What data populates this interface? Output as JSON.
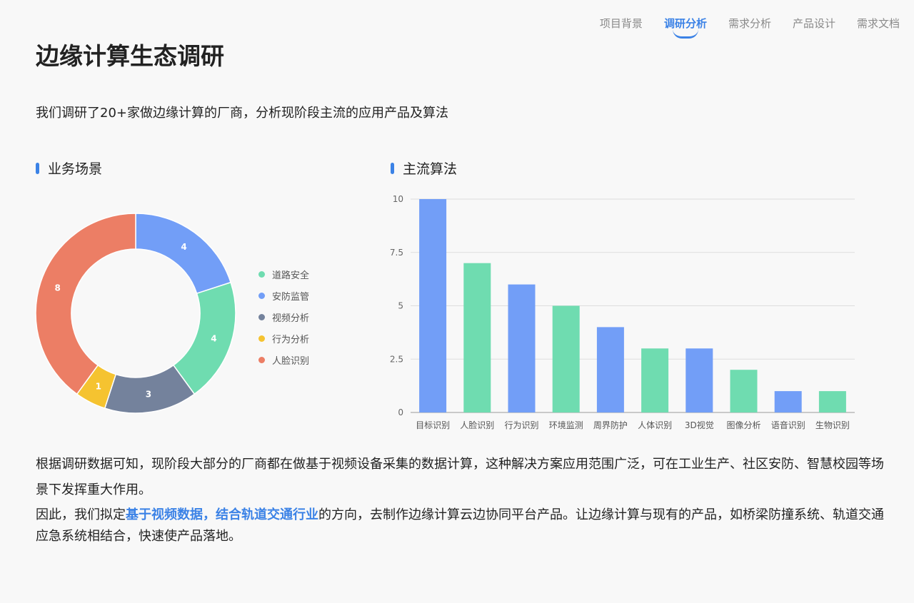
{
  "nav": {
    "items": [
      "项目背景",
      "调研分析",
      "需求分析",
      "产品设计",
      "需求文档"
    ],
    "active_index": 1
  },
  "page_title": "边缘计算生态调研",
  "subtitle": "我们调研了20+家做边缘计算的厂商，分析现阶段主流的应用产品及算法",
  "sections": {
    "left_title": "业务场景",
    "right_title": "主流算法"
  },
  "colors": {
    "accent": "#3b82e6",
    "green": "#6fdcb0",
    "blue": "#729ef7",
    "slate": "#74829c",
    "yellow": "#f5c330",
    "red": "#ec7e65"
  },
  "chart_data": [
    {
      "type": "pie",
      "donut": true,
      "title": "业务场景",
      "categories": [
        "道路安全",
        "安防监管",
        "视频分析",
        "行为分析",
        "人脸识别"
      ],
      "values": [
        4,
        4,
        3,
        1,
        8
      ],
      "slice_order": [
        "安防监管",
        "道路安全",
        "视频分析",
        "行为分析",
        "人脸识别"
      ],
      "colors": [
        "#6fdcb0",
        "#729ef7",
        "#74829c",
        "#f5c330",
        "#ec7e65"
      ],
      "legend_position": "right"
    },
    {
      "type": "bar",
      "title": "主流算法",
      "categories": [
        "目标识别",
        "人脸识别",
        "行为识别",
        "环境监测",
        "周界防护",
        "人体识别",
        "3D视觉",
        "图像分析",
        "语音识别",
        "生物识别"
      ],
      "values": [
        10,
        7,
        6,
        5,
        4,
        3,
        3,
        2,
        1,
        1
      ],
      "bar_colors": [
        "#729ef7",
        "#6fdcb0",
        "#729ef7",
        "#6fdcb0",
        "#729ef7",
        "#6fdcb0",
        "#729ef7",
        "#6fdcb0",
        "#729ef7",
        "#6fdcb0"
      ],
      "ylim": [
        0,
        10
      ],
      "yticks": [
        "0",
        "2.5",
        "5",
        "7.5",
        "10"
      ],
      "grid": true
    }
  ],
  "paragraphs": {
    "p1": "根据调研数据可知，现阶段大部分的厂商都在做基于视频设备采集的数据计算，这种解决方案应用范围广泛，可在工业生产、社区安防、智慧校园等场景下发挥重大作用。",
    "p2_before": "因此，我们拟定",
    "p2_highlight": "基于视频数据，结合轨道交通行业",
    "p2_after": "的方向，去制作边缘计算云边协同平台产品。让边缘计算与现有的产品，如桥梁防撞系统、轨道交通应急系统相结合，快速使产品落地。"
  }
}
